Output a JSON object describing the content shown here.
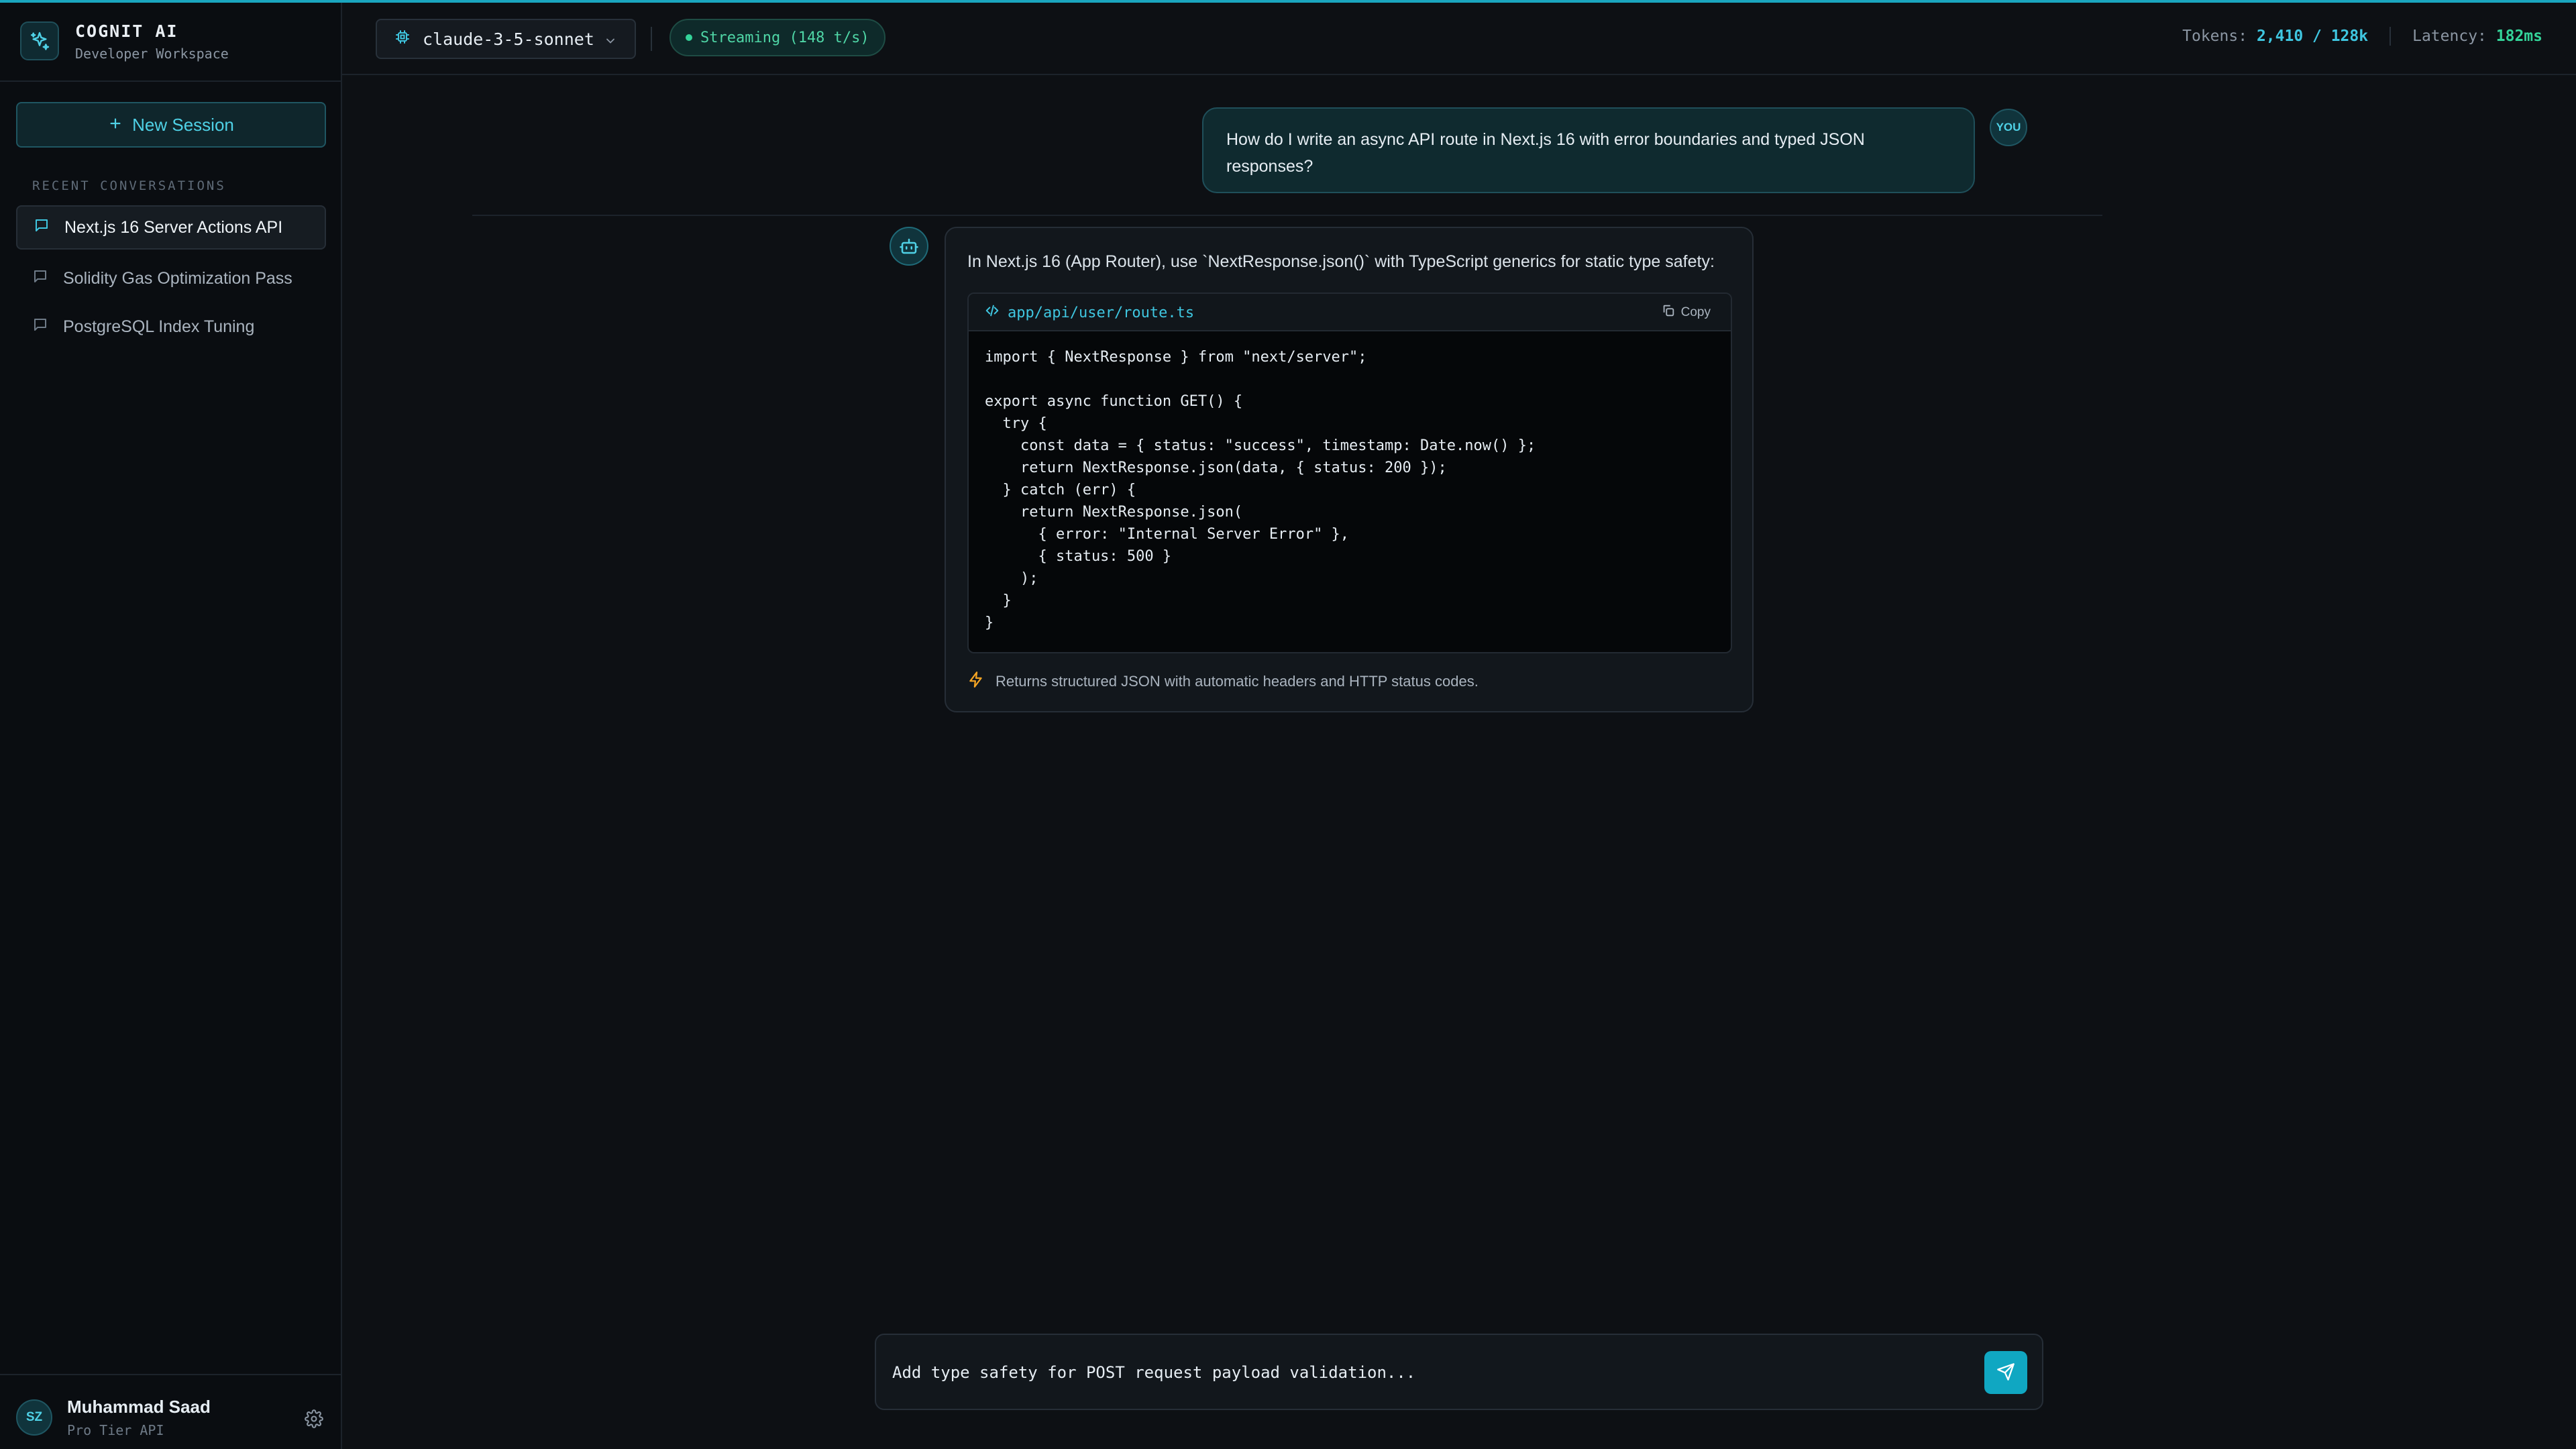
{
  "brand": {
    "title": "COGNIT AI",
    "subtitle": "Developer Workspace"
  },
  "sidebar": {
    "new_session_label": "New Session",
    "section_label": "RECENT CONVERSATIONS",
    "conversations": [
      {
        "title": "Next.js 16 Server Actions API",
        "active": true
      },
      {
        "title": "Solidity Gas Optimization Pass",
        "active": false
      },
      {
        "title": "PostgreSQL Index Tuning",
        "active": false
      }
    ]
  },
  "user": {
    "initials": "SZ",
    "name": "Muhammad Saad",
    "tier": "Pro Tier API"
  },
  "header": {
    "model": "claude-3-5-sonnet",
    "stream_status": "Streaming (148 t/s)",
    "tokens_label": "Tokens:",
    "tokens_value": "2,410 / 128k",
    "latency_label": "Latency:",
    "latency_value": "182ms"
  },
  "chat": {
    "user_badge": "YOU",
    "user_message": "How do I write an async API route in Next.js 16 with error boundaries and typed JSON responses?",
    "assistant": {
      "intro": "In Next.js 16 (App Router), use `NextResponse.json()` with TypeScript generics for static type safety:",
      "code_filename": "app/api/user/route.ts",
      "copy_label": "Copy",
      "code": "import { NextResponse } from \"next/server\";\n\nexport async function GET() {\n  try {\n    const data = { status: \"success\", timestamp: Date.now() };\n    return NextResponse.json(data, { status: 200 });\n  } catch (err) {\n    return NextResponse.json(\n      { error: \"Internal Server Error\" },\n      { status: 500 }\n    );\n  }\n}",
      "footnote": "Returns structured JSON with automatic headers and HTTP status codes."
    }
  },
  "composer": {
    "value": "Add type safety for POST request payload validation..."
  },
  "colors": {
    "accent": "#1aa6bf",
    "success": "#34d399",
    "background": "#0d1014"
  },
  "icons": {
    "brand": "sparkle-icon",
    "new_session": "plus-icon",
    "conversation": "message-square-icon",
    "settings": "gear-icon",
    "model": "cpu-icon",
    "dropdown": "chevron-down-icon",
    "assistant": "bot-icon",
    "code": "code-icon",
    "copy": "copy-icon",
    "footnote": "zap-icon",
    "send": "send-icon"
  }
}
